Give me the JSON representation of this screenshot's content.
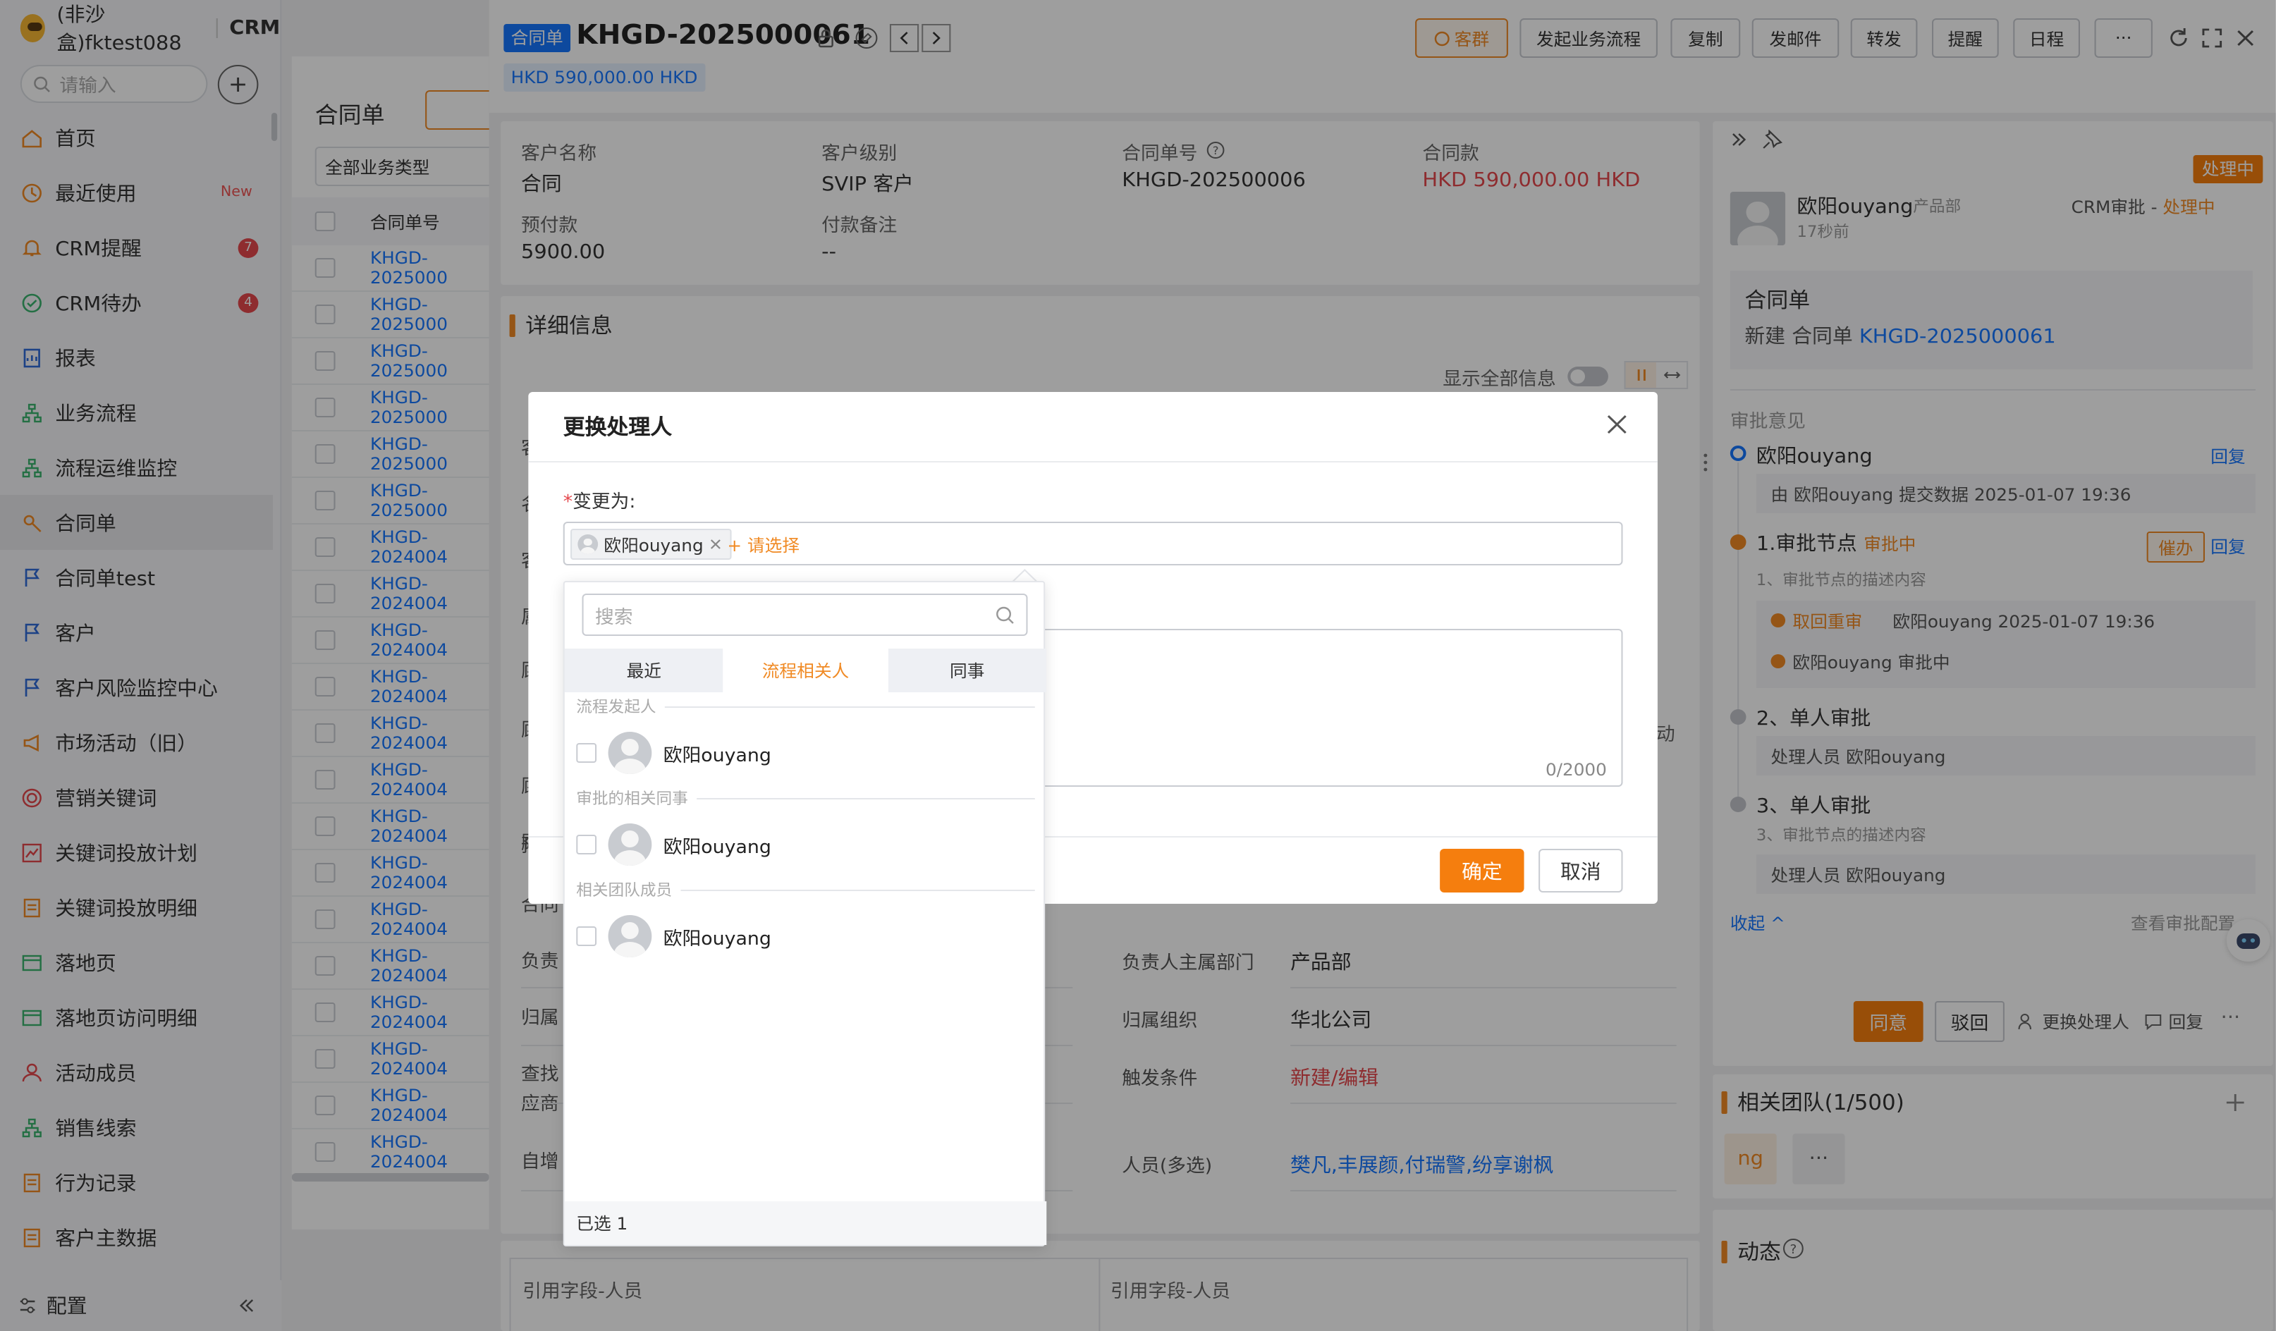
{
  "sidebar": {
    "org": "(非沙盒)fktest088",
    "app": "CRM",
    "search_placeholder": "请输入",
    "items": [
      {
        "label": "首页",
        "icon": "home-icon"
      },
      {
        "label": "最近使用",
        "icon": "clock-icon",
        "new": "New"
      },
      {
        "label": "CRM提醒",
        "icon": "bell-icon",
        "badge": "7"
      },
      {
        "label": "CRM待办",
        "icon": "check-circle-icon",
        "badge": "4"
      },
      {
        "label": "报表",
        "icon": "report-icon"
      },
      {
        "label": "业务流程",
        "icon": "flow-icon"
      },
      {
        "label": "流程运维监控",
        "icon": "flow-icon"
      },
      {
        "label": "合同单",
        "icon": "contract-icon",
        "active": true
      },
      {
        "label": "合同单test",
        "icon": "flag-icon"
      },
      {
        "label": "客户",
        "icon": "flag-icon"
      },
      {
        "label": "客户风险监控中心",
        "icon": "flag-icon"
      },
      {
        "label": "市场活动（旧）",
        "icon": "megaphone-icon"
      },
      {
        "label": "营销关键词",
        "icon": "target-icon"
      },
      {
        "label": "关键词投放计划",
        "icon": "chart-icon"
      },
      {
        "label": "关键词投放明细",
        "icon": "doc-icon"
      },
      {
        "label": "落地页",
        "icon": "page-icon"
      },
      {
        "label": "落地页访问明细",
        "icon": "page-icon"
      },
      {
        "label": "活动成员",
        "icon": "user-icon"
      },
      {
        "label": "销售线索",
        "icon": "flow-icon"
      },
      {
        "label": "行为记录",
        "icon": "doc-icon"
      },
      {
        "label": "客户主数据",
        "icon": "doc-icon"
      }
    ],
    "footer": "配置"
  },
  "list": {
    "title": "合同单",
    "filter": "全部业务类型",
    "header": "合同单号",
    "rows": [
      "KHGD-2025000",
      "KHGD-2025000",
      "KHGD-2025000",
      "KHGD-2025000",
      "KHGD-2025000",
      "KHGD-2025000",
      "KHGD-2024004",
      "KHGD-2024004",
      "KHGD-2024004",
      "KHGD-2024004",
      "KHGD-2024004",
      "KHGD-2024004",
      "KHGD-2024004",
      "KHGD-2024004",
      "KHGD-2024004",
      "KHGD-2024004",
      "KHGD-2024004",
      "KHGD-2024004",
      "KHGD-2024004",
      "KHGD-2024004"
    ]
  },
  "detail": {
    "tag": "合同单",
    "title": "KHGD-2025000061",
    "amount_tag": "HKD 590,000.00 HKD",
    "toolbar": [
      "客群",
      "发起业务流程",
      "复制",
      "发邮件",
      "转发",
      "提醒",
      "日程",
      "···"
    ],
    "summary": [
      {
        "label": "客户名称",
        "value": "合同"
      },
      {
        "label": "客户级别",
        "value": "SVIP 客户"
      },
      {
        "label": "合同单号",
        "value": "KHGD-202500006"
      },
      {
        "label": "合同款",
        "value": "HKD 590,000.00 HKD"
      },
      {
        "label": "预付款",
        "value": "5900.00"
      },
      {
        "label": "付款备注",
        "value": "--"
      }
    ],
    "section": "详细信息",
    "show_all": "显示全部信息",
    "fields_left": [
      "客",
      "名",
      "客",
      "属",
      "顾",
      "顾",
      "顾",
      "顾",
      "预",
      "合同",
      "负责",
      "归属",
      "查找\n应商",
      "自增"
    ],
    "fields_right": [
      {
        "label": "负责人主属部门",
        "value": "产品部"
      },
      {
        "label": "归属组织",
        "value": "华北公司"
      },
      {
        "label": "触发条件",
        "value": "新建/编辑"
      },
      {
        "label": "人员(多选)",
        "value": "樊凡,丰展颜,付瑞警,纷享谢枫"
      }
    ],
    "side_text": "动",
    "bottom_left": "引用字段-人员",
    "bottom_right": "引用字段-人员"
  },
  "approval": {
    "status_badge": "处理中",
    "user": "欧阳ouyang",
    "dept": "产品部",
    "time": "17秒前",
    "flow_name": "CRM审批",
    "flow_status": "处理中",
    "card_title": "合同单",
    "card_desc_prefix": "新建 合同单",
    "card_desc_link": "KHGD-2025000061",
    "opinion_title": "审批意见",
    "steps": [
      {
        "name": "欧阳ouyang",
        "action": "回复",
        "sub": "由 欧阳ouyang 提交数据 2025-01-07 19:36"
      },
      {
        "name": "1.审批节点",
        "status": "审批中",
        "urge": "催办",
        "action": "回复",
        "desc": "1、审批节点的描述内容",
        "sub1_tag": "取回重审",
        "sub1": "欧阳ouyang 2025-01-07 19:36",
        "sub2": "欧阳ouyang 审批中"
      },
      {
        "name": "2、单人审批",
        "sub": "处理人员 欧阳ouyang"
      },
      {
        "name": "3、单人审批",
        "desc": "3、审批节点的描述内容",
        "sub": "处理人员 欧阳ouyang"
      }
    ],
    "collapse": "收起",
    "view_config": "查看审批配置",
    "btn_agree": "同意",
    "btn_reject": "驳回",
    "btn_change": "更换处理人",
    "btn_reply": "回复",
    "team_title": "相关团队(1/500)",
    "team_avatar": "ng",
    "dynamic_title": "动态"
  },
  "modal": {
    "title": "更换处理人",
    "change_label": "变更为:",
    "chip": "欧阳ouyang",
    "pick": "+ 请选择",
    "counter": "0/2000",
    "ok": "确定",
    "cancel": "取消"
  },
  "dropdown": {
    "search_placeholder": "搜索",
    "tabs": [
      "最近",
      "流程相关人",
      "同事"
    ],
    "active_tab": 1,
    "groups": [
      {
        "title": "流程发起人",
        "person": "欧阳ouyang"
      },
      {
        "title": "审批的相关同事",
        "person": "欧阳ouyang"
      },
      {
        "title": "相关团队成员",
        "person": "欧阳ouyang"
      }
    ],
    "selected": "已选 1"
  },
  "colors": {
    "accent": "#f08a24",
    "link": "#1677ff",
    "danger": "#e5484d"
  }
}
